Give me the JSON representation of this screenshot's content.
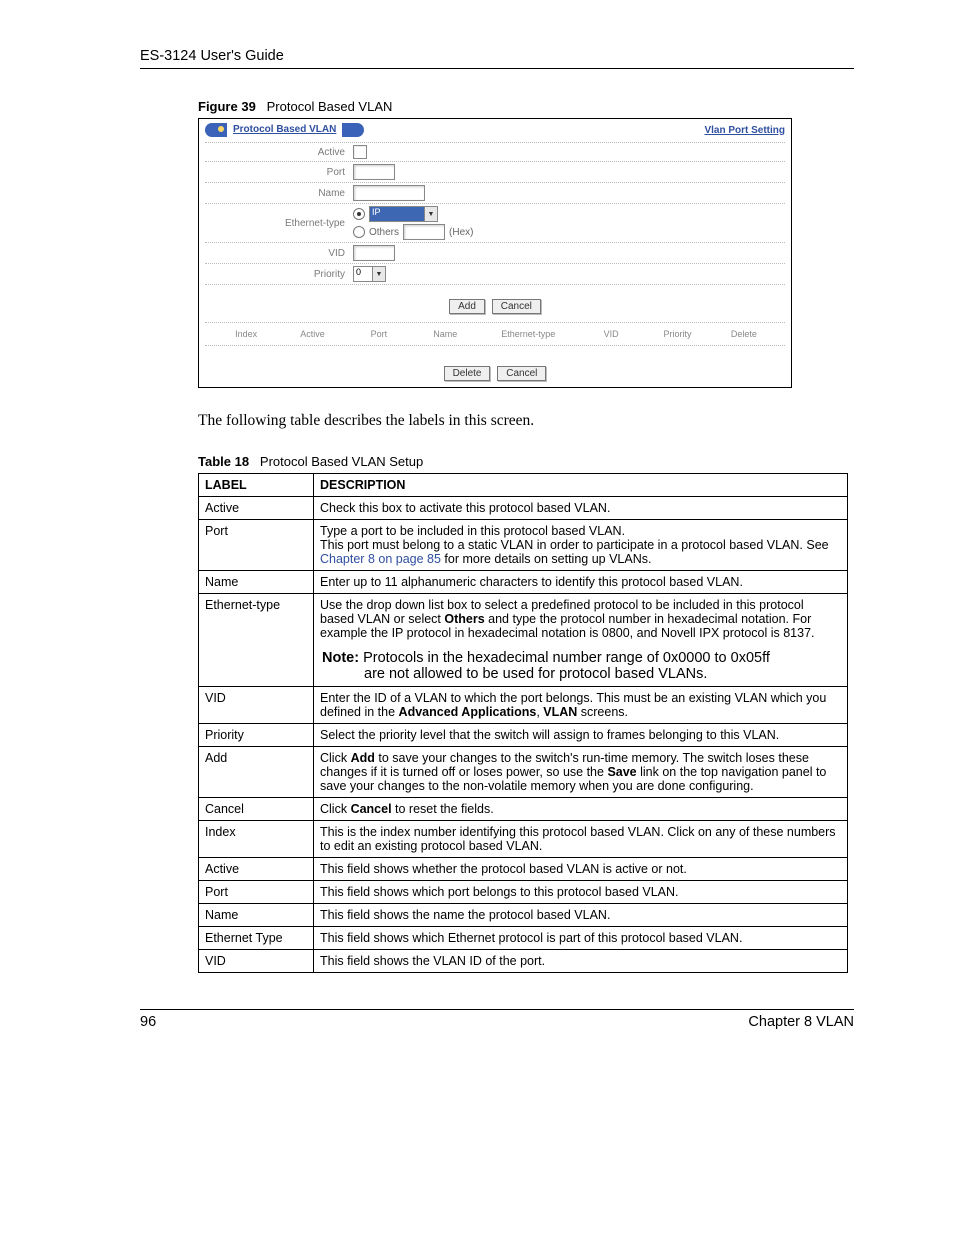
{
  "header": {
    "title": "ES-3124 User's Guide"
  },
  "figure": {
    "caption_label": "Figure 39",
    "caption_text": "Protocol Based VLAN",
    "panel_title": "Protocol Based VLAN",
    "top_link": "Vlan Port Setting",
    "rows": {
      "active": "Active",
      "port": "Port",
      "name": "Name",
      "eth": "Ethernet-type",
      "eth_opt1": "IP",
      "eth_opt2": "Others",
      "eth_hex": "(Hex)",
      "vid": "VID",
      "priority": "Priority",
      "priority_val": "0"
    },
    "buttons": {
      "add": "Add",
      "cancel": "Cancel",
      "delete": "Delete",
      "cancel2": "Cancel"
    },
    "cols": [
      "Index",
      "Active",
      "Port",
      "Name",
      "Ethernet-type",
      "VID",
      "Priority",
      "Delete"
    ]
  },
  "body_text": "The following table describes the labels in this screen.",
  "table": {
    "caption_label": "Table 18",
    "caption_text": "Protocol Based VLAN Setup",
    "head": {
      "label": "LABEL",
      "desc": "DESCRIPTION"
    },
    "rows": [
      {
        "label": "Active",
        "desc": "Check this box to activate this protocol based VLAN."
      },
      {
        "label": "Port",
        "desc_pre": "Type a port to be included in this protocol based VLAN.",
        "desc_line2a": "This port must belong to a static VLAN in order to participate in a protocol based VLAN. See ",
        "desc_link": "Chapter 8 on page 85",
        "desc_line2b": " for more details on setting up VLANs."
      },
      {
        "label": "Name",
        "desc": "Enter up to 11 alphanumeric characters to identify this protocol based VLAN."
      },
      {
        "label": "Ethernet-type",
        "d1a": "Use the drop down list box to select a predefined protocol to be included in this protocol based VLAN or select ",
        "d1b": "Others",
        "d1c": " and type the protocol number in hexadecimal notation. For example the IP protocol in hexadecimal notation is 0800, and Novell IPX protocol is 8137.",
        "note_label": "Note:",
        "note1": " Protocols in the hexadecimal number range of 0x0000 to 0x05ff",
        "note2": "are not allowed to be used for protocol based VLANs."
      },
      {
        "label": "VID",
        "d1": "Enter the ID of a VLAN to which the port belongs. This must be an existing VLAN which you defined in the ",
        "d2": "Advanced Applications",
        "d3": ", ",
        "d4": "VLAN",
        "d5": " screens."
      },
      {
        "label": "Priority",
        "desc": "Select the priority level that the switch will assign to frames belonging to this VLAN."
      },
      {
        "label": "Add",
        "d1": "Click ",
        "d2": "Add",
        "d3": " to save your changes to the switch's run-time memory. The switch loses these changes if it is turned off or loses power, so use the ",
        "d4": "Save",
        "d5": " link on the top navigation panel to save your changes to the non-volatile memory when you are done configuring."
      },
      {
        "label": "Cancel",
        "d1": "Click ",
        "d2": "Cancel",
        "d3": " to reset the fields."
      },
      {
        "label": "Index",
        "desc": "This is the index number identifying this protocol based VLAN. Click on any of these numbers to edit an existing protocol based VLAN."
      },
      {
        "label": "Active",
        "desc": "This field shows whether the protocol based VLAN is active or not."
      },
      {
        "label": "Port",
        "desc": "This field shows which port belongs to this protocol based VLAN."
      },
      {
        "label": "Name",
        "desc": "This field shows the name the protocol based VLAN."
      },
      {
        "label": "Ethernet Type",
        "desc": "This field shows which Ethernet protocol is part of this protocol based VLAN."
      },
      {
        "label": "VID",
        "desc": "This field shows the VLAN ID of the port."
      }
    ]
  },
  "footer": {
    "page": "96",
    "chapter": "Chapter 8 VLAN"
  }
}
